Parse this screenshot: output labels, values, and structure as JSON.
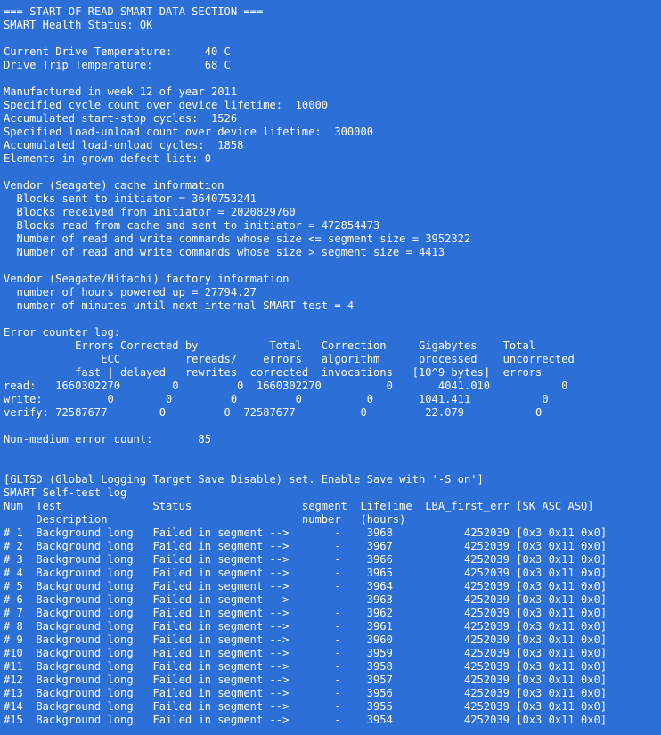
{
  "terminal": {
    "lines": [
      "=== START OF READ SMART DATA SECTION ===",
      "SMART Health Status: OK",
      "",
      "Current Drive Temperature:     40 C",
      "Drive Trip Temperature:        68 C",
      "",
      "Manufactured in week 12 of year 2011",
      "Specified cycle count over device lifetime:  10000",
      "Accumulated start-stop cycles:  1526",
      "Specified load-unload count over device lifetime:  300000",
      "Accumulated load-unload cycles:  1858",
      "Elements in grown defect list: 0",
      "",
      "Vendor (Seagate) cache information",
      "  Blocks sent to initiator = 3640753241",
      "  Blocks received from initiator = 2020829760",
      "  Blocks read from cache and sent to initiator = 472854473",
      "  Number of read and write commands whose size <= segment size = 3952322",
      "  Number of read and write commands whose size > segment size = 4413",
      "",
      "Vendor (Seagate/Hitachi) factory information",
      "  number of hours powered up = 27794.27",
      "  number of minutes until next internal SMART test = 4",
      "",
      "Error counter log:",
      "           Errors Corrected by           Total   Correction     Gigabytes    Total",
      "               ECC          rereads/    errors   algorithm      processed    uncorrected",
      "           fast | delayed   rewrites  corrected  invocations   [10^9 bytes]  errors",
      "read:   1660302270        0         0  1660302270          0       4041.010           0",
      "write:          0        0         0         0          0       1041.411           0",
      "verify: 72587677        0         0  72587677          0         22.079           0",
      "",
      "Non-medium error count:       85",
      "",
      "",
      "[GLTSD (Global Logging Target Save Disable) set. Enable Save with '-S on']",
      "SMART Self-test log",
      "Num  Test              Status                 segment  LifeTime  LBA_first_err [SK ASC ASQ]",
      "     Description                              number   (hours)",
      "# 1  Background long   Failed in segment -->       -    3968           4252039 [0x3 0x11 0x0]",
      "# 2  Background long   Failed in segment -->       -    3967           4252039 [0x3 0x11 0x0]",
      "# 3  Background long   Failed in segment -->       -    3966           4252039 [0x3 0x11 0x0]",
      "# 4  Background long   Failed in segment -->       -    3965           4252039 [0x3 0x11 0x0]",
      "# 5  Background long   Failed in segment -->       -    3964           4252039 [0x3 0x11 0x0]",
      "# 6  Background long   Failed in segment -->       -    3963           4252039 [0x3 0x11 0x0]",
      "# 7  Background long   Failed in segment -->       -    3962           4252039 [0x3 0x11 0x0]",
      "# 8  Background long   Failed in segment -->       -    3961           4252039 [0x3 0x11 0x0]",
      "# 9  Background long   Failed in segment -->       -    3960           4252039 [0x3 0x11 0x0]",
      "#10  Background long   Failed in segment -->       -    3959           4252039 [0x3 0x11 0x0]",
      "#11  Background long   Failed in segment -->       -    3958           4252039 [0x3 0x11 0x0]",
      "#12  Background long   Failed in segment -->       -    3957           4252039 [0x3 0x11 0x0]",
      "#13  Background long   Failed in segment -->       -    3956           4252039 [0x3 0x11 0x0]",
      "#14  Background long   Failed in segment -->       -    3955           4252039 [0x3 0x11 0x0]",
      "#15  Background long   Failed in segment -->       -    3954           4252039 [0x3 0x11 0x0]"
    ]
  },
  "colors": {
    "background": "#2c6fd6",
    "text": "#ffffff"
  }
}
